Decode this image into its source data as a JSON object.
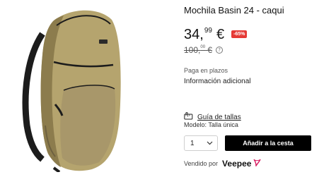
{
  "product": {
    "title": "Mochila Basin 24 - caqui",
    "colors": {
      "body": "#b5a46e",
      "shadow": "#8c7c4d",
      "strap": "#1c1c1c",
      "accent": "#e53935"
    }
  },
  "price": {
    "integer": "34,",
    "decimals": "99",
    "currency": "€",
    "discount": "-65%",
    "old_integer": "100,",
    "old_decimals": "00",
    "old_currency": "€",
    "info_icon": "?"
  },
  "links": {
    "pay": "Paga en plazos",
    "additional_info": "Información adicional",
    "size_guide": "Guía de tallas"
  },
  "model": {
    "label": "Modelo: Talla única"
  },
  "quantity": {
    "value": "1"
  },
  "cart": {
    "add_label": "Añadir a la cesta"
  },
  "seller": {
    "label": "Vendido por",
    "brand": "Veepee"
  }
}
